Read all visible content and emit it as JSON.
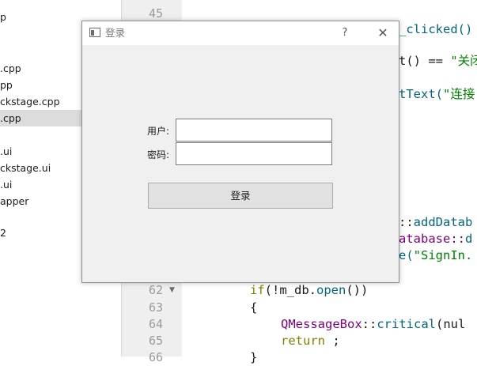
{
  "sidebar": {
    "items": [
      "p",
      "",
      "",
      ".cpp",
      "pp",
      "ckstage.cpp",
      ".cpp",
      "",
      ".ui",
      "ckstage.ui",
      ".ui",
      "apper",
      "",
      "2"
    ]
  },
  "gutter": {
    "line_numbers": [
      "45",
      "",
      "",
      "",
      "",
      "",
      "",
      "",
      "",
      "",
      "",
      "",
      "",
      "",
      "",
      "",
      "",
      "62",
      "63",
      "64",
      "65",
      "66"
    ]
  },
  "code": {
    "l1": "_clicked()",
    "l2_a": "t() == ",
    "l2_b": "\"关闭",
    "l3_a": "tText(",
    "l3_b": "\"连接",
    "l4_a": "::",
    "l4_b": "addDatab",
    "l5_a": "atabase::",
    "l5_b": "d",
    "l6_a": "e(",
    "l6_b": "\"SignIn.",
    "l7_a": "if",
    "l7_b": "(!m_db.",
    "l7_c": "open",
    "l7_d": "())",
    "l8": "{",
    "l9_a": "QMessageBox",
    "l9_b": "::",
    "l9_c": "critical",
    "l9_d": "(nul",
    "l10_a": "return",
    "l10_b": " ;",
    "l11": "}"
  },
  "dialog": {
    "title": "登录",
    "help": "?",
    "close": "✕",
    "user_label": "用户:",
    "user_value": "",
    "password_label": "密码:",
    "password_value": "",
    "login_button": "登录"
  }
}
